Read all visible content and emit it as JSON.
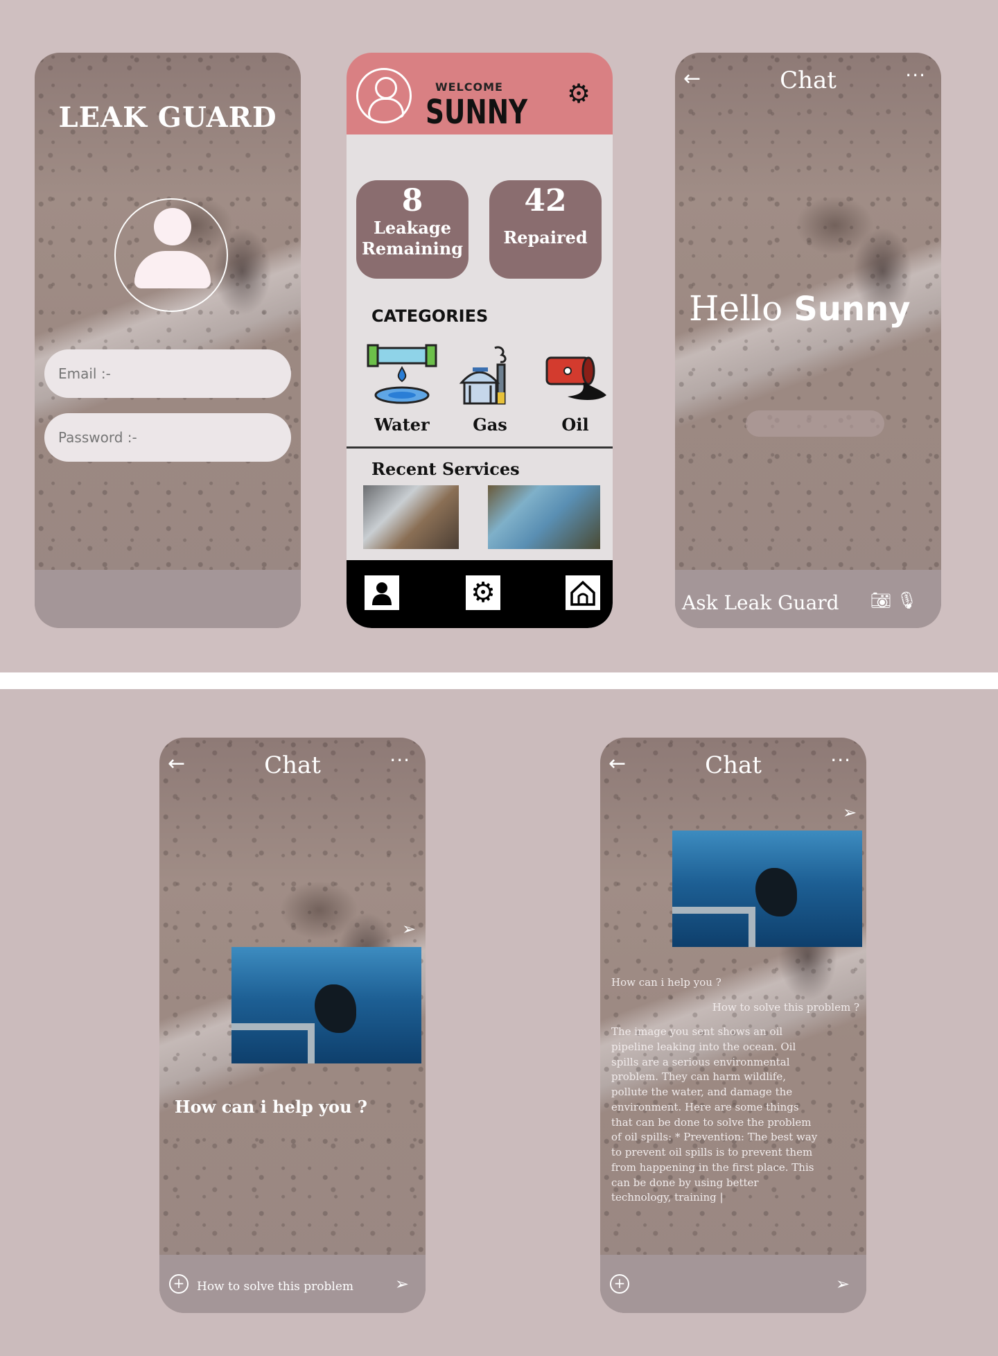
{
  "login": {
    "title": "LEAK GUARD",
    "email_placeholder": "Email :-",
    "password_placeholder": "Password :-"
  },
  "home": {
    "welcome": "WELCOME",
    "username": "SUNNY",
    "stats": [
      {
        "value": "8",
        "label_line1": "Leakage",
        "label_line2": "Remaining"
      },
      {
        "value": "42",
        "label": "Repaired"
      }
    ],
    "categories_title": "CATEGORIES",
    "categories": [
      {
        "label": "Water",
        "icon": "water-pipe-icon"
      },
      {
        "label": "Gas",
        "icon": "gas-plant-icon"
      },
      {
        "label": "Oil",
        "icon": "oil-barrel-icon"
      }
    ],
    "recent_title": "Recent Services",
    "nav": [
      {
        "icon": "profile-icon"
      },
      {
        "icon": "gear-icon"
      },
      {
        "icon": "home-icon"
      }
    ]
  },
  "chat_screens": {
    "title": "Chat",
    "back_glyph": "←",
    "more_glyph": "···",
    "hello": "Hello",
    "hello_name": "Sunny",
    "ask_placeholder": "Ask Leak Guard",
    "bot_greeting": "How can i help you ?",
    "input_value": "How to solve this problem",
    "user_message": "How to solve this problem ?",
    "answer": "The image you sent shows an oil pipeline leaking into the ocean. Oil spills are a serious environmental problem. They can harm wildlife, pollute the water, and damage the environment. Here are some things that can be done to solve the problem of oil spills: * Prevention: The best way to prevent oil spills is to prevent them from happening in the first place. This can be done by using better technology, training |"
  },
  "colors": {
    "home_header": "#d98083",
    "stat_card": "#8a6d6f",
    "background": "#cdbdbe"
  }
}
